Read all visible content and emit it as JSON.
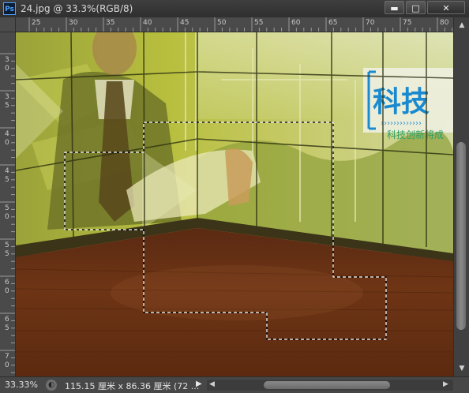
{
  "app": {
    "icon_label": "Ps"
  },
  "window": {
    "title": "24.jpg @ 33.3%(RGB/8)",
    "minimize_label": "▬",
    "maximize_label": "□",
    "close_label": "✕"
  },
  "rulers": {
    "top_labels": [
      "25",
      "30",
      "35",
      "40",
      "45",
      "50",
      "55",
      "60",
      "65",
      "70",
      "75",
      "80"
    ],
    "left_labels": [
      "3\n0",
      "3\n5",
      "4\n0",
      "4\n5",
      "5\n0",
      "5\n5",
      "6\n0",
      "6\n5",
      "7\n0"
    ]
  },
  "canvas": {
    "sign_title": "科技",
    "sign_subtitle": "科技创新将成",
    "icons": [
      "selection-marquee"
    ]
  },
  "status": {
    "zoom": "33.33%",
    "doc_size": "115.15 厘米 x 86.36 厘米 (72 ..."
  }
}
